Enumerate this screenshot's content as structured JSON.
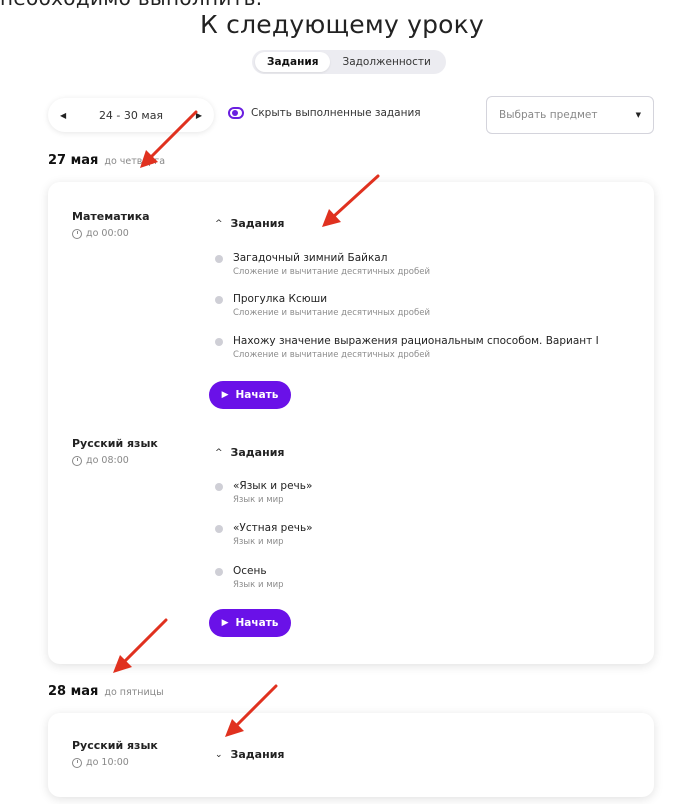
{
  "cut_text": "необходимо выполнить.",
  "page_title": "К следующему уроку",
  "tabs": [
    {
      "label": "Задания",
      "active": true
    },
    {
      "label": "Задолженности",
      "active": false
    }
  ],
  "filters": {
    "week_range": "24 - 30 мая",
    "toggle_label": "Скрыть выполненные задания",
    "subject_placeholder": "Выбрать предмет"
  },
  "days": [
    {
      "date": "27 мая",
      "until": "до четверга",
      "subjects": [
        {
          "name": "Математика",
          "due": "до 00:00",
          "tasks_label": "Задания",
          "tasks": [
            {
              "title": "Загадочный зимний Байкал",
              "subtitle": "Сложение и вычитание десятичных дробей"
            },
            {
              "title": "Прогулка Ксюши",
              "subtitle": "Сложение и вычитание десятичных дробей"
            },
            {
              "title": "Нахожу значение выражения рациональным способом. Вариант I",
              "subtitle": "Сложение и вычитание десятичных дробей"
            }
          ],
          "start_label": "Начать"
        },
        {
          "name": "Русский язык",
          "due": "до 08:00",
          "tasks_label": "Задания",
          "tasks": [
            {
              "title": "«Язык и речь»",
              "subtitle": "Язык и мир"
            },
            {
              "title": "«Устная речь»",
              "subtitle": "Язык и мир"
            },
            {
              "title": "Осень",
              "subtitle": "Язык и мир"
            }
          ],
          "start_label": "Начать"
        }
      ]
    },
    {
      "date": "28 мая",
      "until": "до пятницы",
      "subjects": [
        {
          "name": "Русский язык",
          "due": "до 10:00",
          "tasks_label": "Задания"
        }
      ]
    }
  ],
  "colors": {
    "accent": "#6a11e8",
    "annotation_arrow": "#e0311f"
  },
  "icons": {
    "prev": "triangle-left",
    "next": "triangle-right",
    "dropdown": "triangle-down",
    "clock": "clock-icon",
    "expanded": "chevron-up",
    "collapsed": "chevron-down",
    "play": "play-icon"
  }
}
